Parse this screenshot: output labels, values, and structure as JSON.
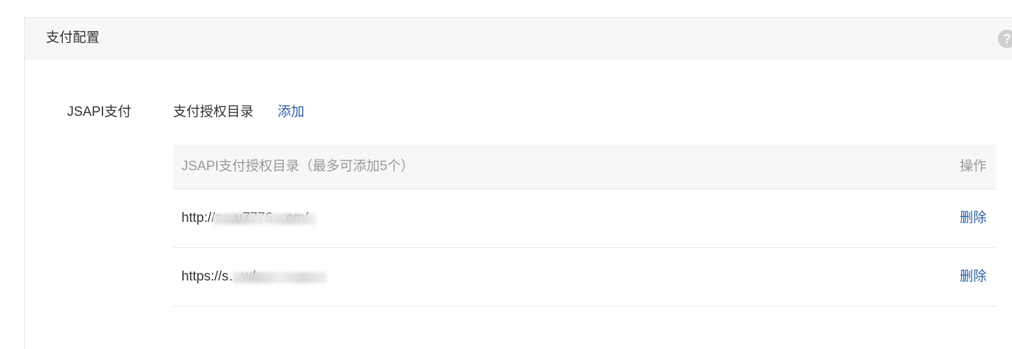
{
  "panel": {
    "title": "支付配置",
    "help_icon": "help-icon",
    "help_glyph": "?"
  },
  "jsapi": {
    "section_label": "JSAPI支付",
    "row_label": "支付授权目录",
    "add_label": "添加"
  },
  "table": {
    "headers": {
      "directory": "JSAPI支付授权目录（最多可添加5个）",
      "operation": "操作"
    },
    "rows": [
      {
        "url": "http://s…u7776…om/",
        "action": "删除"
      },
      {
        "url": "https://s…w/",
        "action": "删除"
      }
    ]
  },
  "colors": {
    "link": "#2b5fa8",
    "header_bg": "#f7f7f7",
    "muted_text": "#999999"
  }
}
